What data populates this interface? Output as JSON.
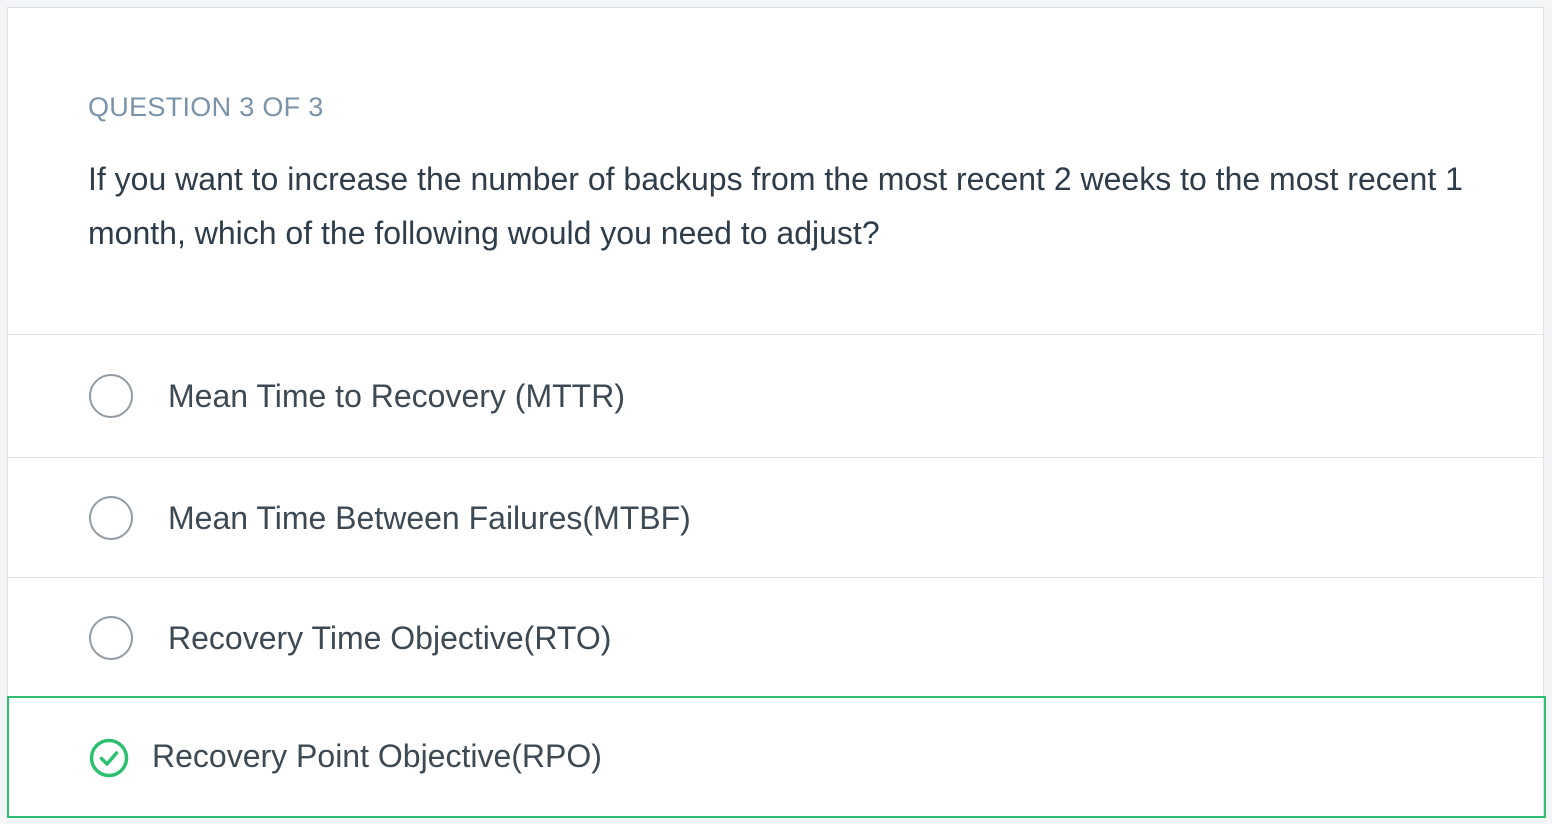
{
  "quiz": {
    "counter": "QUESTION 3 OF 3",
    "question": "If you want to increase the number of backups from the most recent 2 weeks to the most recent 1 month, which of the following would you need to adjust?",
    "options": [
      {
        "label": "Mean Time to Recovery (MTTR)",
        "selected": false
      },
      {
        "label": "Mean Time Between Failures(MTBF)",
        "selected": false
      },
      {
        "label": "Recovery Time Objective(RTO)",
        "selected": false
      },
      {
        "label": "Recovery Point Objective(RPO)",
        "selected": true
      }
    ],
    "colors": {
      "correct": "#2fbf71",
      "counter": "#7a93a8",
      "text": "#2e3d49",
      "radio_border": "#929ba3"
    },
    "icons": {
      "unselected": "radio-circle-icon",
      "selected": "check-circle-icon"
    }
  }
}
